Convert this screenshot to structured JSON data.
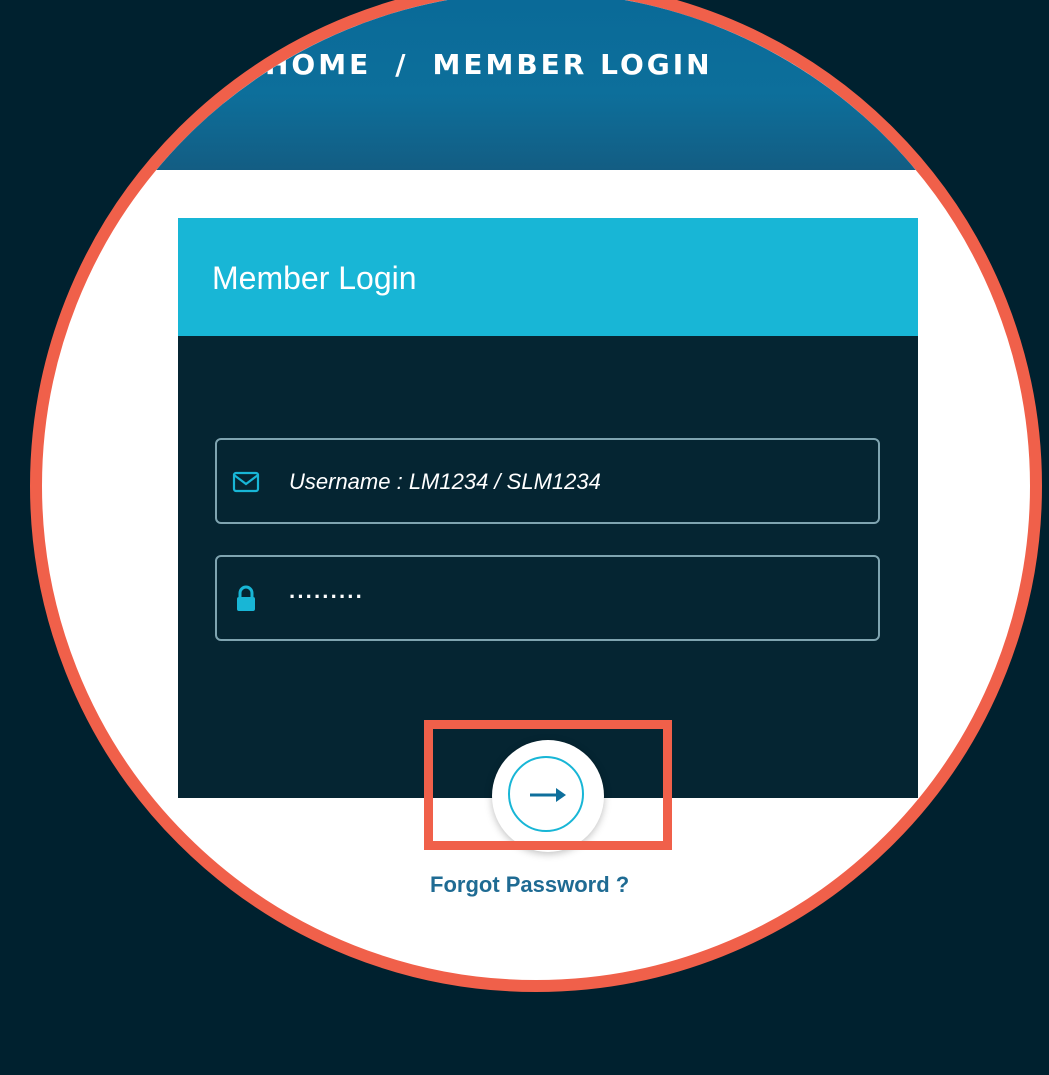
{
  "breadcrumb": {
    "home": "HOME",
    "separator": "/",
    "current": "MEMBER LOGIN"
  },
  "login_card": {
    "title": "Member Login",
    "username_placeholder": "Username : LM1234 / SLM1234",
    "password_value": "·········",
    "submit_icon": "arrow-right-icon"
  },
  "forgot_password": "Forgot Password ?",
  "colors": {
    "background": "#00212f",
    "highlight": "#f0604a",
    "header_band": "#0d6f9b",
    "card_header": "#18b6d6",
    "card_body": "#052532",
    "link": "#1f6b93"
  }
}
